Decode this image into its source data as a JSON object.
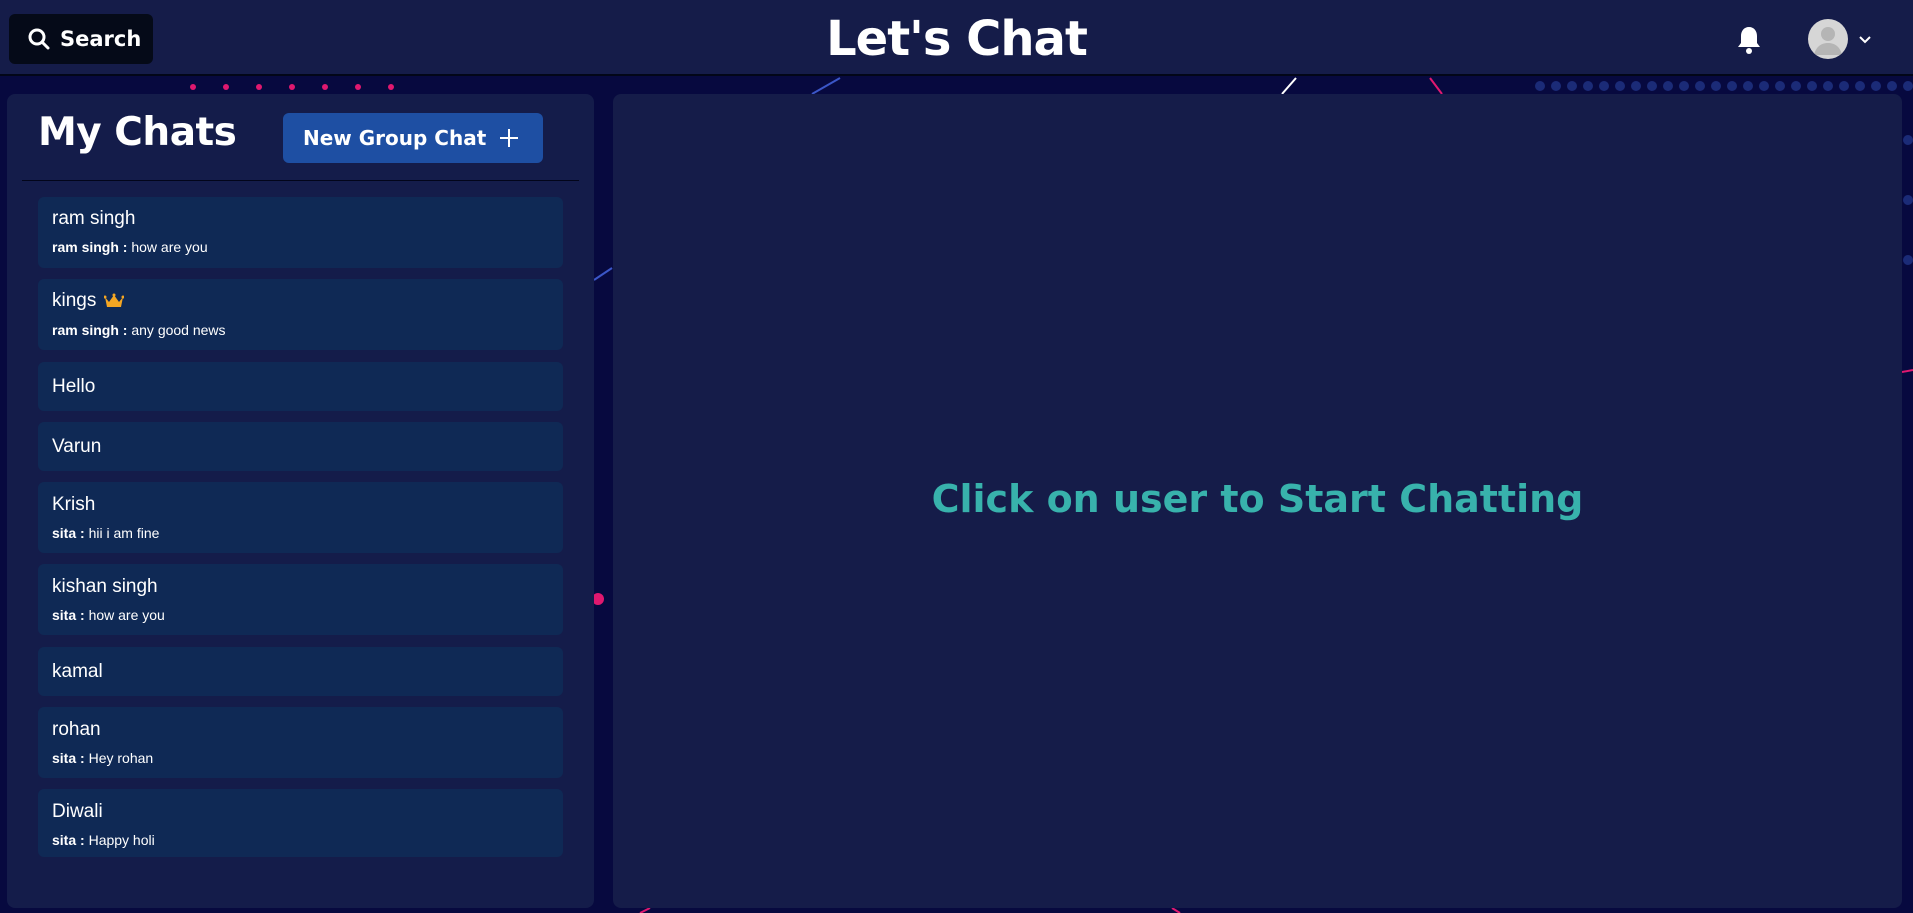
{
  "header": {
    "search_label": "Search",
    "app_title": "Let's Chat"
  },
  "sidebar": {
    "title": "My Chats",
    "new_group_label": "New Group Chat",
    "chats": [
      {
        "name": "ram singh",
        "sender": "ram singh :",
        "message": "how are you"
      },
      {
        "name": "kings",
        "sender": "ram singh :",
        "message": "any good news",
        "badge_icon": "crown-icon"
      },
      {
        "name": "Hello"
      },
      {
        "name": "Varun"
      },
      {
        "name": "Krish",
        "sender": "sita :",
        "message": "hii i am fine"
      },
      {
        "name": "kishan singh",
        "sender": "sita :",
        "message": "how are you"
      },
      {
        "name": "kamal"
      },
      {
        "name": "rohan",
        "sender": "sita :",
        "message": "Hey rohan"
      },
      {
        "name": "Diwali",
        "sender": "sita :",
        "message": "Happy holi"
      }
    ]
  },
  "main": {
    "placeholder": "Click on user to Start Chatting"
  },
  "colors": {
    "background": "#07093f",
    "panel": "#151c49",
    "chat_item": "#0f2955",
    "button_blue": "#1e4fa3",
    "accent_teal": "#38b2ac",
    "decor_pink": "#e0186f"
  }
}
